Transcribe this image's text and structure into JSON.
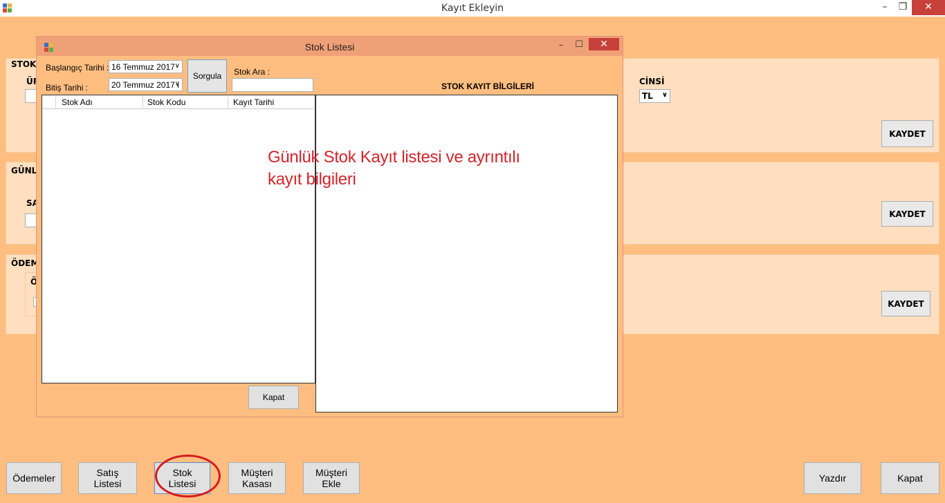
{
  "main_window": {
    "title": "Kayıt Ekleyin",
    "controls": {
      "minimize": "–",
      "restore": "❐",
      "close": "✕"
    }
  },
  "background": {
    "group1_label": "STOK",
    "group1_sub": "ÜR",
    "cinsi_label": "CİNSİ",
    "cinsi_value": "TL",
    "group2_label": "GÜNL",
    "group2_sub": "SA",
    "group3_label": "ÖDEM",
    "group3_sub": "Ö",
    "kaydet_label": "KAYDET"
  },
  "dialog": {
    "title": "Stok Listesi",
    "controls": {
      "minimize": "–",
      "maximize": "☐",
      "close": "✕"
    },
    "baslangic_label": "Başlangıç Tarihi :",
    "baslangic_value": "16 Temmuz 2017",
    "bitis_label": "Bitiş Tarihi :",
    "bitis_value": "20 Temmuz 2017 l",
    "sorgula_label": "Sorgula",
    "stok_ara_label": "Stok Ara :",
    "stok_ara_value": "",
    "detail_title": "STOK KAYIT BİLGİLERİ",
    "grid_columns": [
      "Stok Adı",
      "Stok Kodu",
      "Kayıt Tarihi"
    ],
    "kapat_label": "Kapat"
  },
  "annotation": {
    "line1": "Günlük Stok Kayıt listesi ve ayrıntılı",
    "line2": "kayıt bilgileri",
    "color": "#D3242A"
  },
  "bottom_buttons": {
    "odemeler": "Ödemeler",
    "satis_line1": "Satış",
    "satis_line2": "Listesi",
    "stok_line1": "Stok",
    "stok_line2": "Listesi",
    "musteri_kasasi_line1": "Müşteri",
    "musteri_kasasi_line2": "Kasası",
    "musteri_ekle_line1": "Müşteri",
    "musteri_ekle_line2": "Ekle",
    "yazdir": "Yazdır",
    "kapat": "Kapat"
  }
}
